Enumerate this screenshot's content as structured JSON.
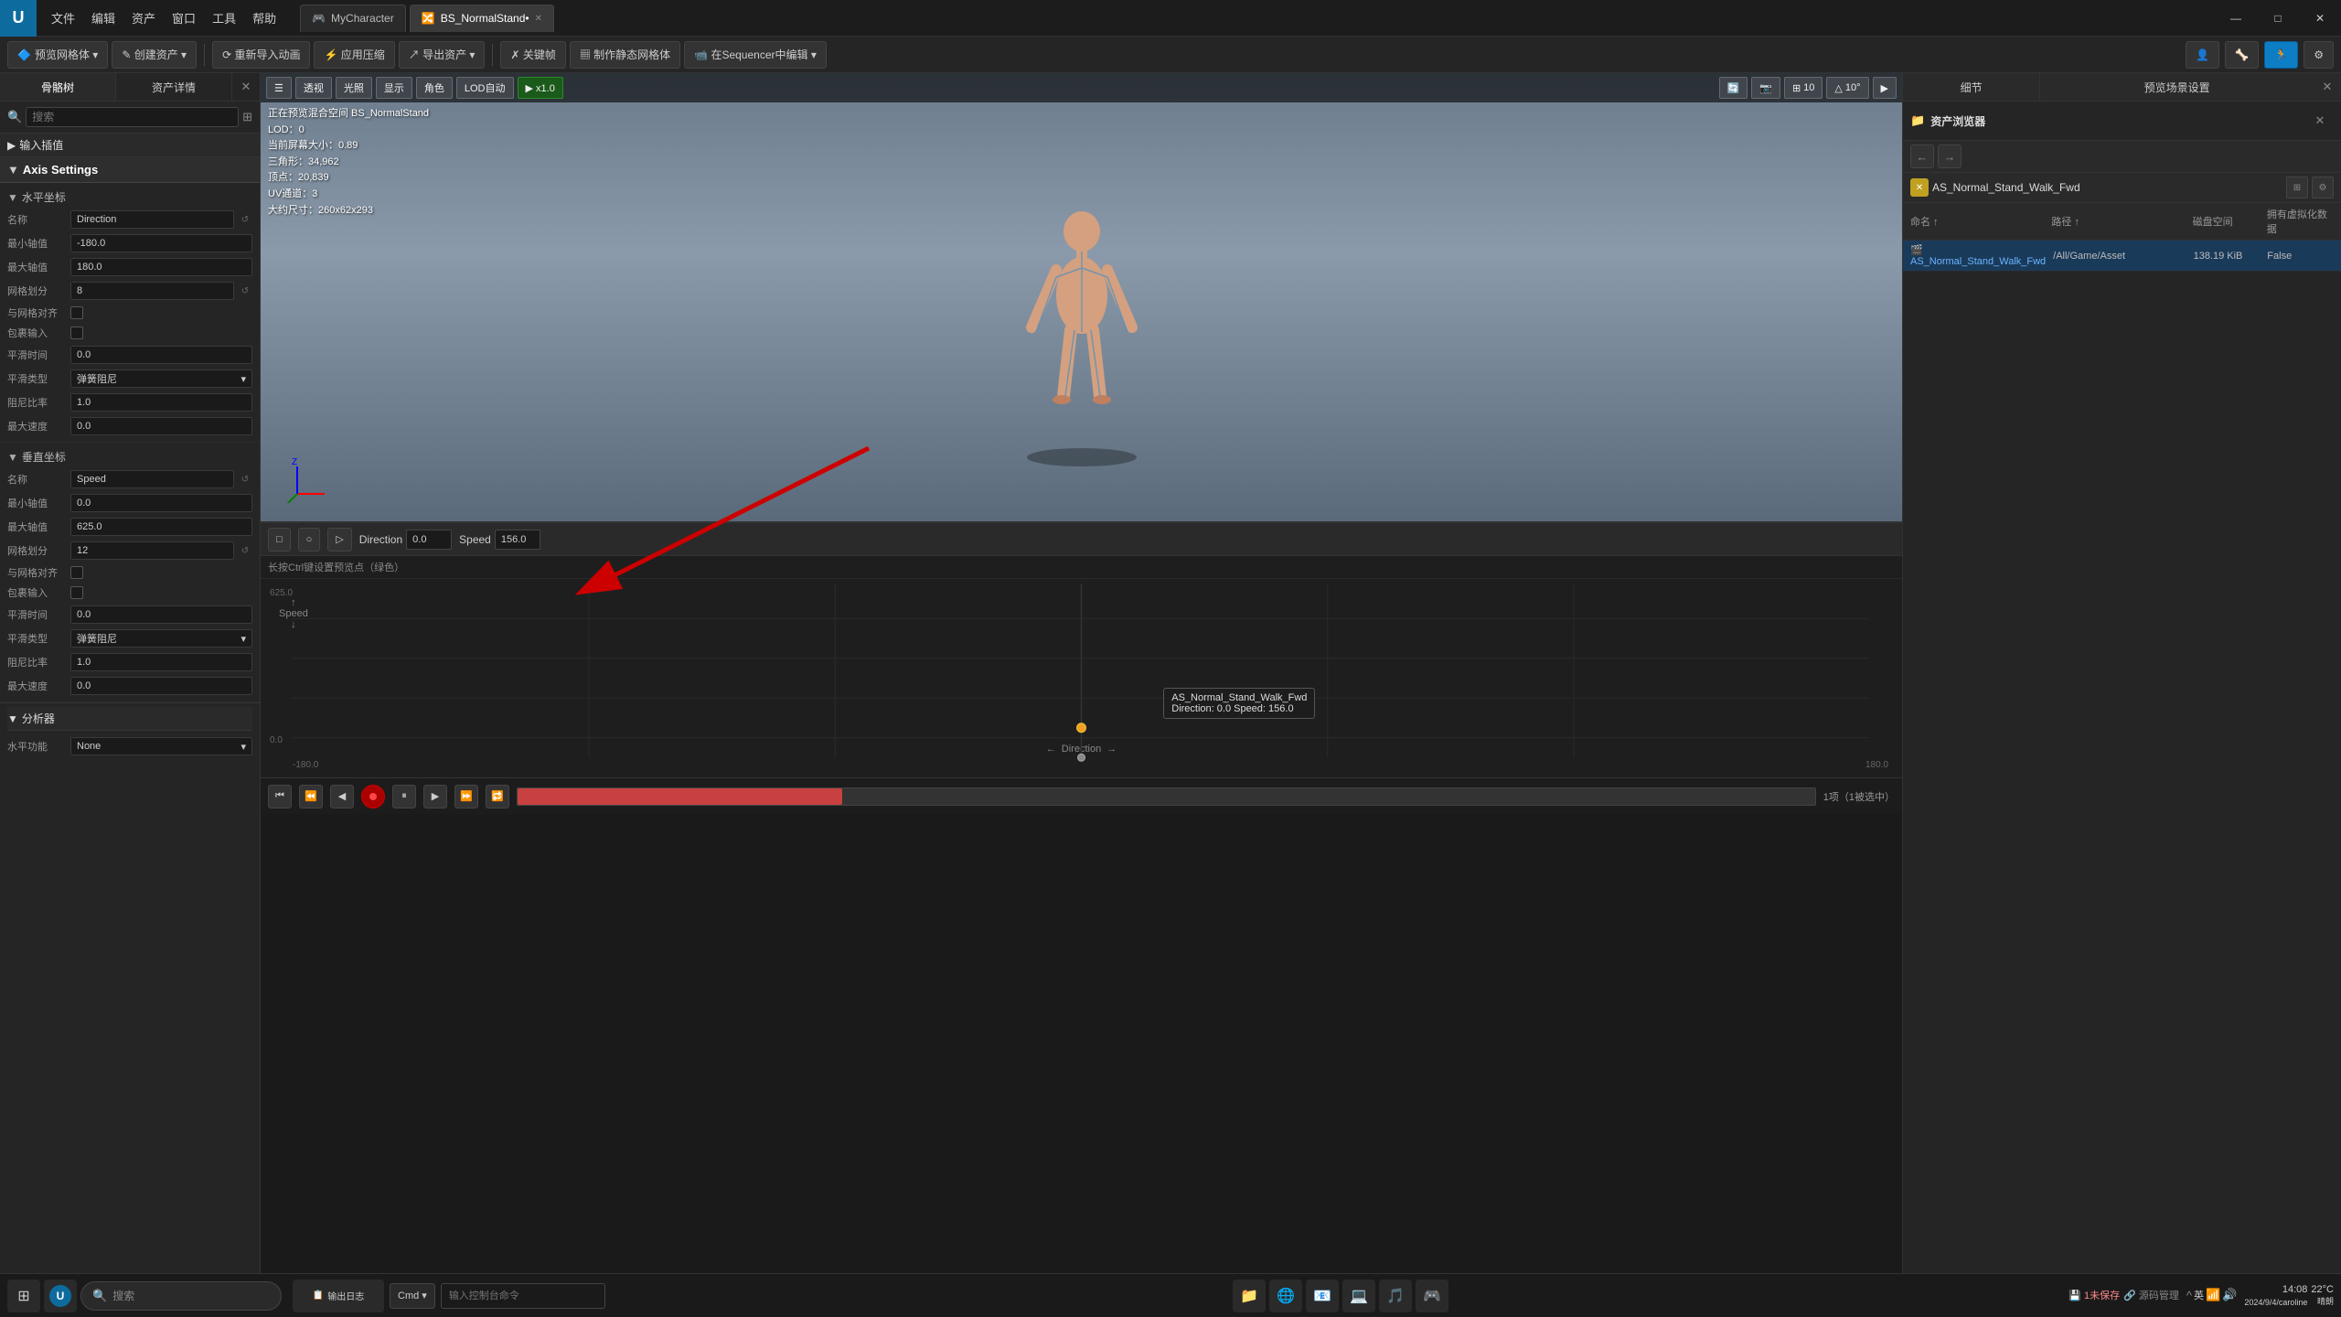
{
  "titlebar": {
    "logo": "U",
    "menus": [
      "文件",
      "编辑",
      "资产",
      "窗口",
      "工具",
      "帮助"
    ],
    "tab1": {
      "label": "MyCharacter",
      "icon": "🎮"
    },
    "tab2": {
      "label": "BS_NormalStand•",
      "icon": "🔀",
      "active": true
    },
    "win_min": "—",
    "win_max": "□",
    "win_close": "✕"
  },
  "toolbar": {
    "btn1": "预览网格体 ▾",
    "btn2": "✎ 创建资产 ▾",
    "btn3": "⟳ 重新导入动画",
    "btn4": "⚡ 应用压缩",
    "btn5": "↗ 导出资产 ▾",
    "btn6": "✗ 关键帧",
    "btn7": "▦ 制作静态网格体",
    "btn8": "📹 在Sequencer中编辑 ▾"
  },
  "left_panel": {
    "tab1": "骨骼树",
    "tab2": "资产详情",
    "search_placeholder": "搜索",
    "section_input": "输入插值",
    "axis_settings_label": "Axis Settings",
    "horizontal_axis_label": "水平坐标",
    "vertical_axis_label": "垂直坐标",
    "h_axis": {
      "name_label": "名称",
      "name_value": "Direction",
      "min_label": "最小轴值",
      "min_value": "-180.0",
      "max_label": "最大轴值",
      "max_value": "180.0",
      "grid_label": "网格划分",
      "grid_value": "8",
      "snap_label": "与网格对齐",
      "clamp_label": "包裹输入",
      "smooth_label": "平滑时间",
      "smooth_value": "0.0",
      "interp_label": "平滑类型",
      "interp_value": "弹簧阻尼",
      "damp_label": "阻尼比率",
      "damp_value": "1.0",
      "speed_label": "最大速度",
      "speed_value": "0.0"
    },
    "v_axis": {
      "name_label": "名称",
      "name_value": "Speed",
      "min_label": "最小轴值",
      "min_value": "0.0",
      "max_label": "最大轴值",
      "max_value": "625.0",
      "grid_label": "网格划分",
      "grid_value": "12",
      "snap_label": "与网格对齐",
      "clamp_label": "包裹输入",
      "smooth_label": "平滑时间",
      "smooth_value": "0.0",
      "interp_label": "平滑类型",
      "interp_value": "弹簧阻尼",
      "damp_label": "阻尼比率",
      "damp_value": "1.0",
      "speed_label": "最大速度",
      "speed_value": "0.0"
    },
    "analysis_label": "分析器",
    "h_func_label": "水平功能",
    "h_func_value": "None"
  },
  "viewport": {
    "btn_menu": "☰",
    "btn_perspective": "透视",
    "btn_lighting": "光照",
    "btn_show": "显示",
    "btn_character": "角色",
    "btn_lod": "LOD自动",
    "btn_play": "▶ x1.0",
    "btn_lod_num": "10",
    "btn_angle": "10°",
    "info_preview": "正在预览混合空间 BS_NormalStand",
    "info_lod": "LOD：0",
    "info_screen": "当前屏幕大小：0.89",
    "info_triangles": "三角形：34,962",
    "info_vertices": "顶点：20,839",
    "info_uv": "UV通道：3",
    "info_size": "大约尺寸：260x62x293"
  },
  "graph": {
    "toolbar_btns": [
      "□",
      "○",
      "▷"
    ],
    "dir_label": "Direction",
    "dir_value": "0.0",
    "speed_label": "Speed",
    "speed_value": "156.0",
    "hint": "长按Ctrl键设置预览点（绿色）",
    "y_top": "625.0",
    "y_zero": "0.0",
    "x_left": "-180.0",
    "x_right": "180.0",
    "speed_axis_label": "Speed",
    "direction_axis_label": "Direction",
    "point_name": "AS_Normal_Stand_Walk_Fwd",
    "point_dir": "0.0",
    "point_speed": "156.0",
    "tooltip_line1": "AS_Normal_Stand_Walk_Fwd",
    "tooltip_line2": "Direction: 0.0  Speed: 156.0"
  },
  "right_panel": {
    "browser_title": "资产浏览器",
    "back_btn": "←",
    "forward_btn": "→",
    "asset_path": "AS_Normal_Stand_Walk_Fwd",
    "col_name": "命名 ↑",
    "col_path": "路径 ↑",
    "col_size": "磁盘空间",
    "col_virt": "拥有虚拟化数据",
    "row1_name": "AS_Normal_Stand_Walk_Fwd",
    "row1_path": "/All/Game/Asset",
    "row1_size": "138.19 KiB",
    "row1_virt": "False",
    "detail_btn": "细节",
    "preview_btn": "预览场景设置"
  },
  "bottom_bar": {
    "status": "1项（1被选中）"
  },
  "taskbar": {
    "start_icon": "⊞",
    "search_placeholder": "搜索",
    "time": "14:08",
    "date": "2024/9/4/caroline",
    "temp": "22°C",
    "weather": "晴朗",
    "lang": "英",
    "output_log": "输出日志",
    "cmd_label": "Cmd ▾",
    "terminal_placeholder": "输入控制台命令",
    "unsaved": "1未保存",
    "source": "源码管理"
  }
}
